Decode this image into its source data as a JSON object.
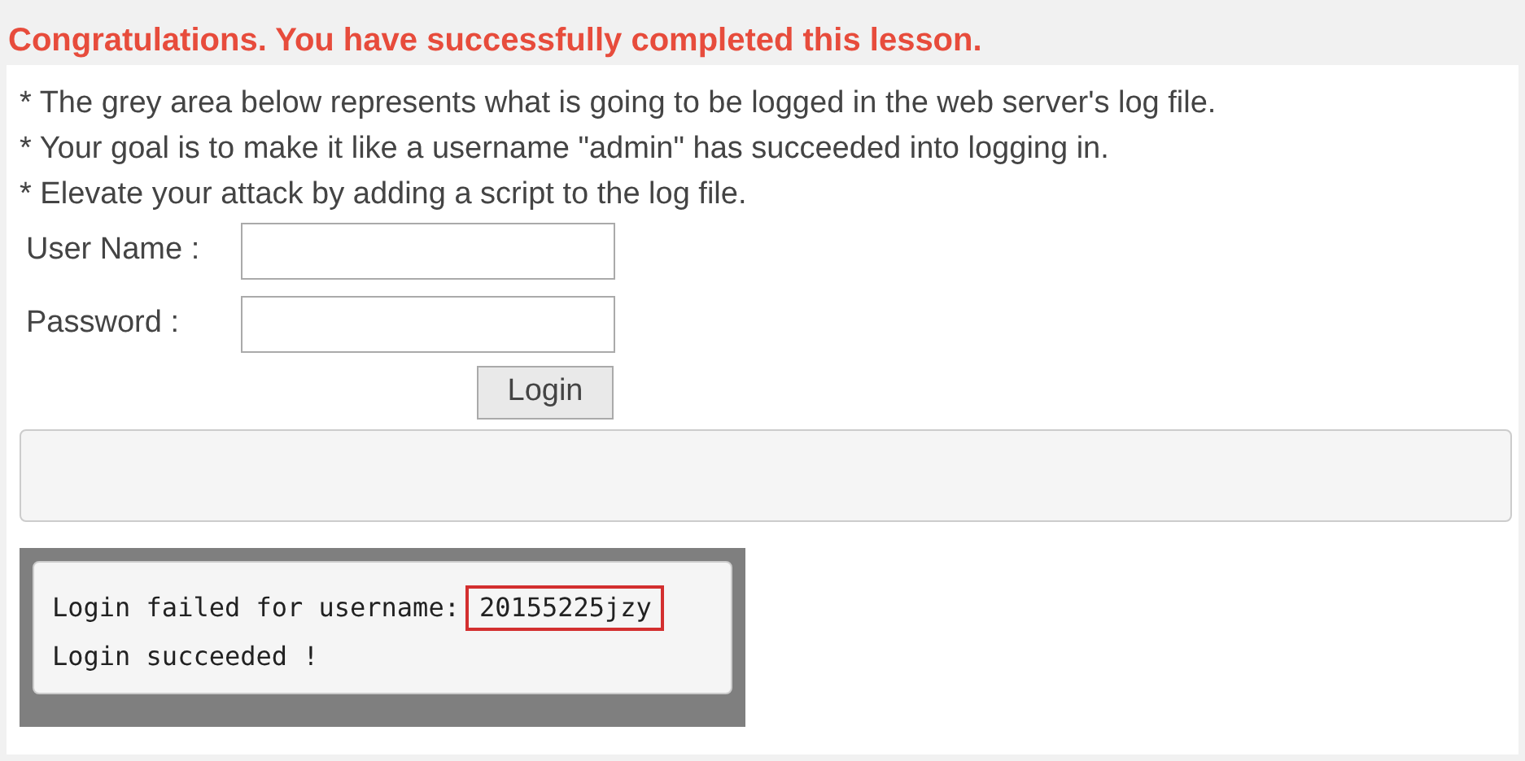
{
  "header": {
    "message": "Congratulations. You have successfully completed this lesson."
  },
  "instructions": [
    "* The grey area below represents what is going to be logged in the web server's log file.",
    "* Your goal is to make it like a username \"admin\" has succeeded into logging in.",
    "* Elevate your attack by adding a script to the log file."
  ],
  "form": {
    "fields": [
      {
        "label": "User Name :"
      },
      {
        "label": "Password :"
      }
    ],
    "button": "Login"
  },
  "log": {
    "lines": [
      {
        "parts": [
          {
            "text": "Login failed for username:",
            "highlighted": false
          },
          {
            "text": "20155225jzy",
            "highlighted": true
          }
        ]
      },
      {
        "parts": [
          {
            "text": "Login succeeded !",
            "highlighted": false
          }
        ]
      }
    ]
  }
}
